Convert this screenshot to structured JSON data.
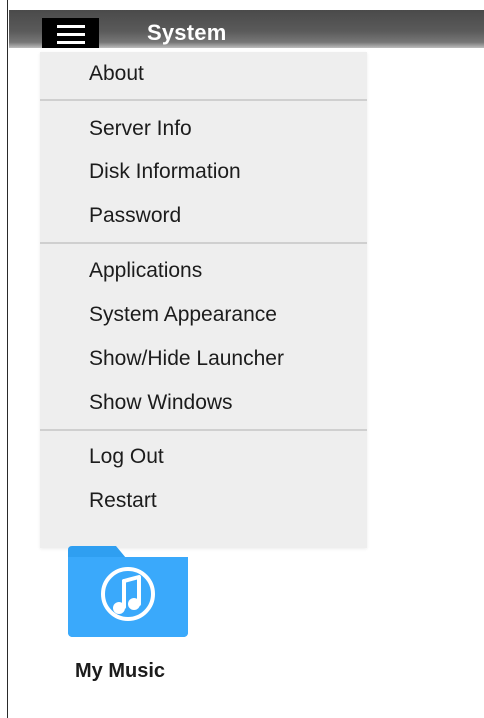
{
  "header": {
    "title": "System"
  },
  "menu": {
    "items": [
      "About",
      "Server Info",
      "Disk Information",
      "Password",
      "Applications",
      "System Appearance",
      "Show/Hide Launcher",
      "Show Windows",
      "Log Out",
      "Restart"
    ]
  },
  "desktop": {
    "icon_label": "My Music",
    "icon": "music-note-icon"
  },
  "colors": {
    "topbar": "#4a4a4a",
    "menu_bg": "#eeeeee",
    "folder_blue": "#2e9bef"
  }
}
